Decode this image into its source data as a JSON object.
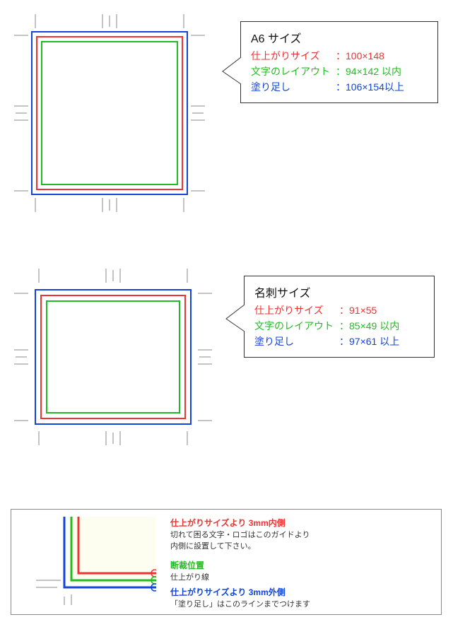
{
  "panels": [
    {
      "title": "A6 サイズ",
      "rows": [
        {
          "label": "仕上がりサイズ",
          "value": "：100×148",
          "color": "c-red"
        },
        {
          "label": "文字のレイアウト",
          "value": "：94×142 以内",
          "color": "c-green"
        },
        {
          "label": "塗り足し",
          "value": "：106×154以上",
          "color": "c-blue"
        }
      ]
    },
    {
      "title": "名刺サイズ",
      "rows": [
        {
          "label": "仕上がりサイズ",
          "value": "：91×55",
          "color": "c-red"
        },
        {
          "label": "文字のレイアウト",
          "value": "：85×49 以内",
          "color": "c-green"
        },
        {
          "label": "塗り足し",
          "value": "：97×61 以上",
          "color": "c-blue"
        }
      ]
    }
  ],
  "legend": [
    {
      "title": "仕上がりサイズより 3mm内側",
      "desc1": "切れて困る文字・ロゴはこのガイドより",
      "desc2": "内側に設置して下さい。",
      "color": "c-red"
    },
    {
      "title": "断裁位置",
      "desc1": "仕上がり線",
      "desc2": "",
      "color": "c-green"
    },
    {
      "title": "仕上がりサイズより 3mm外側",
      "desc1": "「塗り足し」はこのラインまでつけます",
      "desc2": "",
      "color": "c-blue"
    }
  ]
}
